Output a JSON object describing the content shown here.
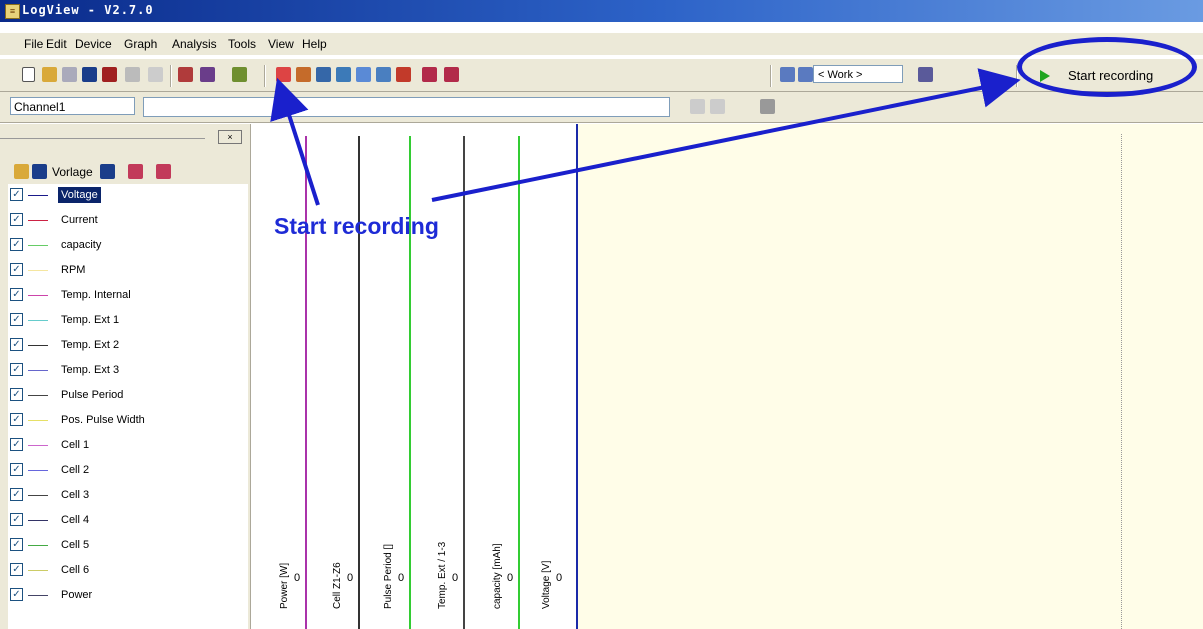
{
  "window": {
    "title": "LogView - V2.7.0"
  },
  "menu": [
    "File",
    "Edit",
    "Device",
    "Graph",
    "Analysis",
    "Tools",
    "View",
    "Help"
  ],
  "toolbar": {
    "work_combo": "< Work >",
    "start_recording": "Start recording"
  },
  "channel_bar": {
    "channel_select": "Channel1"
  },
  "channel_panel": {
    "profile_label": "Vorlage"
  },
  "channels": [
    {
      "label": "Voltage",
      "color": "#1a1a8a",
      "checked": true
    },
    {
      "label": "Current",
      "color": "#cc2244",
      "checked": true
    },
    {
      "label": "capacity",
      "color": "#66cc66",
      "checked": true
    },
    {
      "label": "RPM",
      "color": "#f5e6a0",
      "checked": true
    },
    {
      "label": "Temp. Internal",
      "color": "#cc44aa",
      "checked": true
    },
    {
      "label": "Temp. Ext 1",
      "color": "#66cccc",
      "checked": true
    },
    {
      "label": "Temp. Ext 2",
      "color": "#333333",
      "checked": true
    },
    {
      "label": "Temp. Ext 3",
      "color": "#6666cc",
      "checked": true
    },
    {
      "label": "Pulse Period",
      "color": "#444444",
      "checked": true
    },
    {
      "label": "Pos. Pulse Width",
      "color": "#e6e066",
      "checked": true
    },
    {
      "label": "Cell 1",
      "color": "#cc66cc",
      "checked": true
    },
    {
      "label": "Cell 2",
      "color": "#6666dd",
      "checked": true
    },
    {
      "label": "Cell 3",
      "color": "#444444",
      "checked": true
    },
    {
      "label": "Cell 4",
      "color": "#333366",
      "checked": true
    },
    {
      "label": "Cell 5",
      "color": "#44aa44",
      "checked": true
    },
    {
      "label": "Cell 6",
      "color": "#cccc66",
      "checked": true
    },
    {
      "label": "Power",
      "color": "#444466",
      "checked": true
    }
  ],
  "axes": [
    {
      "label": "Power [W]",
      "zero": "0",
      "color": "#aa33aa"
    },
    {
      "label": "Cell Z1-Z6",
      "zero": "0",
      "color": "#333333"
    },
    {
      "label": "Pulse Period []",
      "zero": "0",
      "color": "#33cc33"
    },
    {
      "label": "Temp. Ext / 1-3",
      "zero": "0",
      "color": "#444444"
    },
    {
      "label": "capacity [mAh]",
      "zero": "0",
      "color": "#33cc33"
    },
    {
      "label": "Voltage [V]",
      "zero": "0",
      "color": "#ffffff"
    }
  ],
  "annotation": {
    "text": "Start recording"
  }
}
